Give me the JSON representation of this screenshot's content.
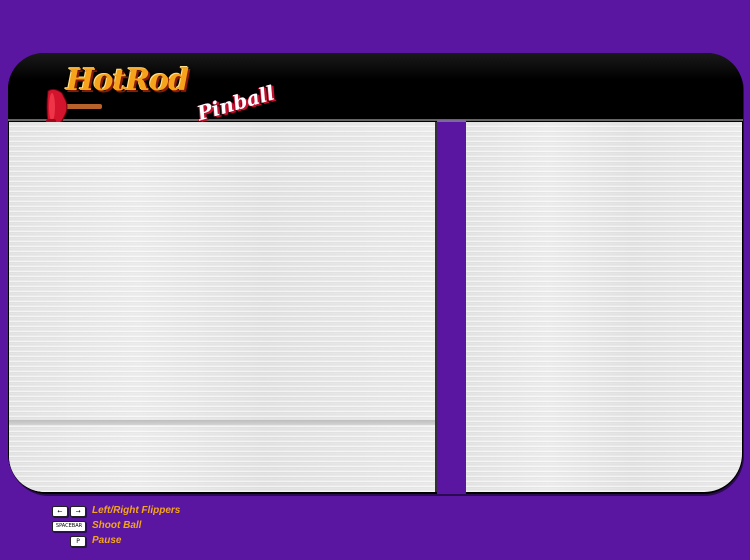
{
  "logo": {
    "title": "HotRod",
    "subtitle": "Pinball"
  },
  "colors": {
    "background": "#5a16a0",
    "header": "#000000",
    "panel": "#e8e8e8",
    "legend_text": "#f4a51c"
  },
  "controls": [
    {
      "keys": [
        "←",
        "→"
      ],
      "label": "Left/Right Flippers",
      "icon": "arrow-keys-icon"
    },
    {
      "keys": [
        "SPACEBAR"
      ],
      "label": "Shoot Ball",
      "icon": "spacebar-key-icon"
    },
    {
      "keys": [
        "P"
      ],
      "label": "Pause",
      "icon": "p-key-icon"
    }
  ]
}
